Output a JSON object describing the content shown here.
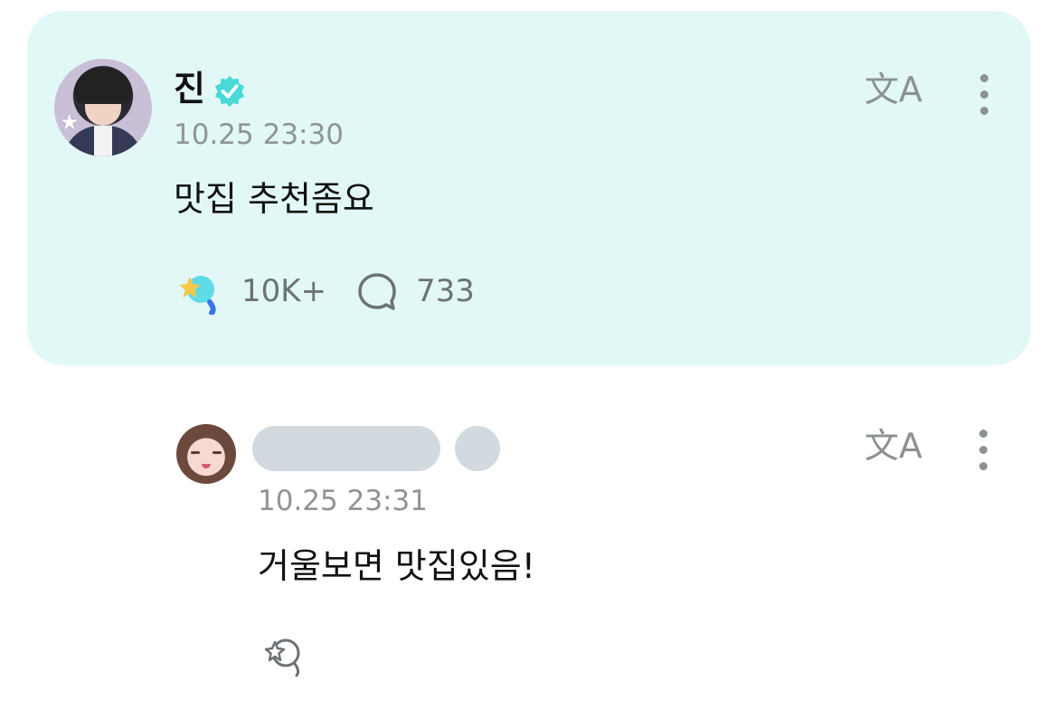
{
  "post": {
    "author": "진",
    "timestamp": "10.25 23:30",
    "text": "맛집 추천좀요",
    "translate_glyph": "文A",
    "reactions": "10K+",
    "comments": "733"
  },
  "reply": {
    "timestamp": "10.25 23:31",
    "text": "거울보면 맛집있음!",
    "translate_glyph": "文A"
  },
  "colors": {
    "card_background": "#e2f8f7",
    "verified": "#4ad8d8",
    "icon_gray": "#8c9193"
  },
  "icons": {
    "verified": "verified-check-icon",
    "translate": "translate-icon",
    "more": "more-vertical-icon",
    "reaction": "star-balloon-icon",
    "comment": "speech-bubble-icon"
  }
}
